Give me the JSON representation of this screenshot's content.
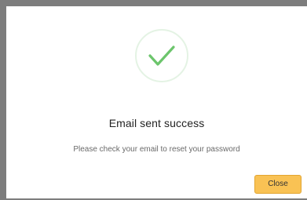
{
  "dialog": {
    "icon": "check-icon",
    "title": "Email sent success",
    "message": "Please check your email to reset your password",
    "close_label": "Close"
  },
  "colors": {
    "success_green": "#6cc56c",
    "success_ring": "#e4f3e4",
    "button_bg": "#f9c254",
    "button_border": "#e2a531"
  }
}
